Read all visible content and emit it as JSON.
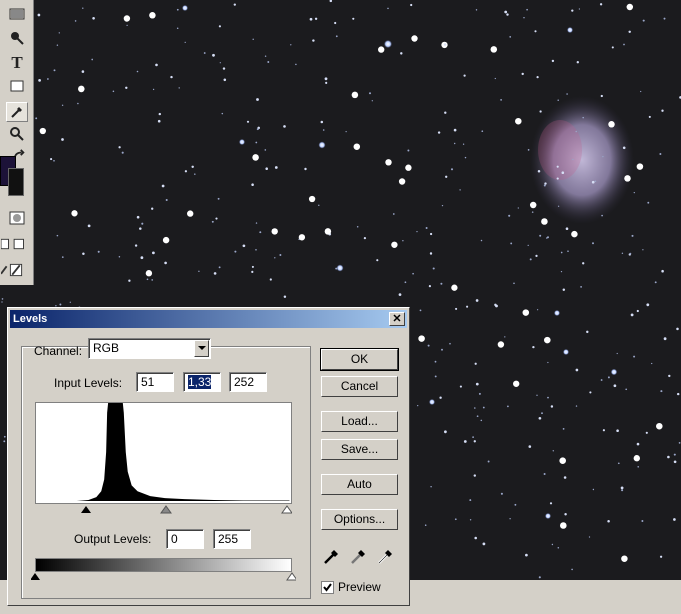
{
  "dialog": {
    "title": "Levels",
    "close_glyph": "✕",
    "channel_label": "Channel:",
    "channel_value": "RGB",
    "input_levels_label": "Input Levels:",
    "input_black": "51",
    "input_gamma": "1,33",
    "input_white": "252",
    "output_levels_label": "Output Levels:",
    "output_black": "0",
    "output_white": "255",
    "buttons": {
      "ok": "OK",
      "cancel": "Cancel",
      "load": "Load...",
      "save": "Save...",
      "auto": "Auto",
      "options": "Options..."
    },
    "preview_label": "Preview",
    "preview_checked": true
  },
  "toolbox": {
    "tools": [
      "gradient-tool-icon",
      "burn-tool-icon",
      "type-tool-icon",
      "shape-tool-icon",
      "eyedropper-tool-icon",
      "zoom-tool-icon",
      "swap-colors-icon",
      "foreground-color-swatch",
      "quick-mask-icon",
      "screen-mode-icon",
      "jump-to-imageready-icon"
    ],
    "foreground_color": "#1c1238"
  },
  "colors": {
    "title_bar_start": "#0a246a",
    "title_bar_end": "#a6caf0",
    "dialog_face": "#d4d0c8",
    "nebula": "#b7aad0"
  }
}
